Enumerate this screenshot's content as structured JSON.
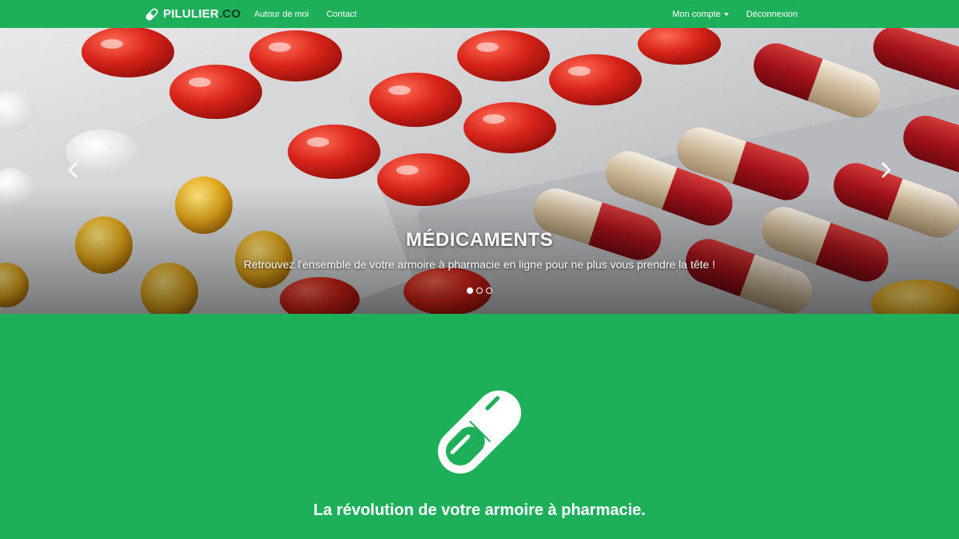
{
  "navbar": {
    "brand_main": "PILULIER",
    "brand_tld": ".CO",
    "brand_icon": "pill-icon",
    "left_links": [
      "Autour de moi",
      "Contact"
    ],
    "account_label": "Mon compte",
    "logout_label": "Déconnexion",
    "color": "#1eaf5a"
  },
  "carousel": {
    "title": "MÉDICAMENTS",
    "subtitle": "Retrouvez l'ensemble de votre armoire à pharmacie en ligne pour ne plus vous prendre la tête !",
    "indicators": 3,
    "active_indicator": 1,
    "prev_icon": "chevron-left-icon",
    "next_icon": "chevron-right-icon"
  },
  "hero": {
    "icon": "pill-icon",
    "tagline": "La révolution de votre armoire à pharmacie.",
    "background": "#1eaf5a"
  }
}
